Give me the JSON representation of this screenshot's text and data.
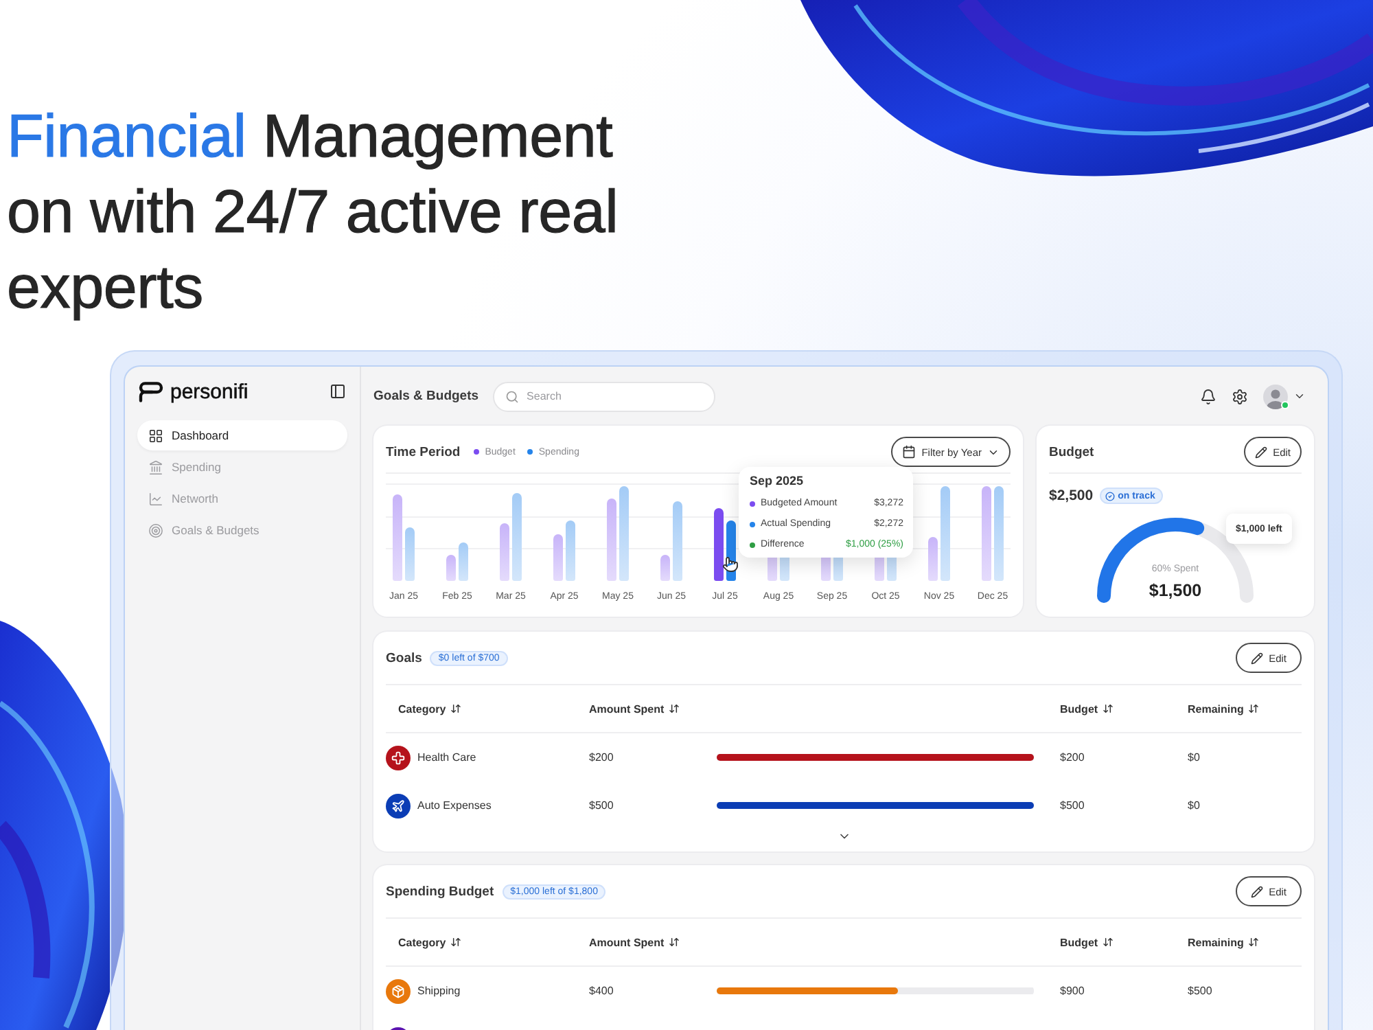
{
  "headline": {
    "lines": [
      [
        {
          "text": "Financial",
          "accent": true
        },
        {
          "text": " Management",
          "accent": false
        }
      ],
      [
        {
          "text": "on with 24/7 active real",
          "accent": false
        }
      ],
      [
        {
          "text": "experts",
          "accent": false
        }
      ]
    ]
  },
  "sidebar": {
    "logo": "personifi",
    "items": [
      {
        "label": "Dashboard",
        "selected": true
      },
      {
        "label": "Spending",
        "selected": false
      },
      {
        "label": "Networth",
        "selected": false
      },
      {
        "label": "Goals & Budgets",
        "selected": false
      }
    ]
  },
  "header": {
    "title": "Goals & Budgets",
    "search": {
      "placeholder": "Search"
    },
    "user": {
      "online": true
    }
  },
  "time_period": {
    "title": "Time Period",
    "legend": [
      {
        "label": "Budget",
        "color": "#7b4cf0"
      },
      {
        "label": "Spending",
        "color": "#2584ea"
      }
    ],
    "filter": "Filter by Year",
    "months": [
      {
        "label": "Jan 25",
        "selected": false
      },
      {
        "label": "Feb 25",
        "selected": false
      },
      {
        "label": "Mar 25",
        "selected": false
      },
      {
        "label": "Apr 25",
        "selected": false
      },
      {
        "label": "May 25",
        "selected": false
      },
      {
        "label": "Jun 25",
        "selected": false
      },
      {
        "label": "Jul 25",
        "selected": true
      },
      {
        "label": "Aug 25",
        "selected": false
      },
      {
        "label": "Sep 25",
        "selected": false
      },
      {
        "label": "Oct 25",
        "selected": false
      },
      {
        "label": "Nov 25",
        "selected": false
      },
      {
        "label": "Dec 25",
        "selected": false
      }
    ],
    "tooltip": {
      "title": "Sep 2025",
      "rows": [
        {
          "label": "Budgeted Amount",
          "value": "$3,272",
          "color": "#7b4cf0",
          "highlight": false
        },
        {
          "label": "Actual Spending",
          "value": "$2,272",
          "color": "#2584ea",
          "highlight": false
        },
        {
          "label": "Difference",
          "value": "$1,000 (25%)",
          "color": "#2f9e44",
          "highlight": true
        }
      ]
    }
  },
  "budget": {
    "title": "Budget",
    "edit": "Edit",
    "amount": "$2,500",
    "status": "on track",
    "gauge": {
      "level": 0.6,
      "caption": "60% Spent",
      "value": "$1,500",
      "callout": "$1,000 left"
    }
  },
  "goals": {
    "title": "Goals",
    "badge": "$0 left of $700",
    "edit": "Edit",
    "columns": [
      "Category",
      "Amount Spent",
      "Budget",
      "Remaining"
    ],
    "rows": [
      {
        "category": "Health Care",
        "color": "#b5121b",
        "spent": "$200",
        "level": 1,
        "budget": "$200",
        "remaining": "$0"
      },
      {
        "category": "Auto Expenses",
        "color": "#0b3db5",
        "spent": "$500",
        "level": 1,
        "budget": "$500",
        "remaining": "$0"
      }
    ],
    "expand_toggle": true
  },
  "spending_budget": {
    "title": "Spending Budget",
    "badge": "$1,000 left of $1,800",
    "edit": "Edit",
    "columns": [
      "Category",
      "Amount Spent",
      "Budget",
      "Remaining"
    ],
    "rows": [
      {
        "category": "Shipping",
        "color": "#e8780c",
        "spent": "$400",
        "level": 0.57,
        "budget": "$900",
        "remaining": "$500"
      },
      {
        "color": "#5a12b0"
      }
    ]
  }
}
